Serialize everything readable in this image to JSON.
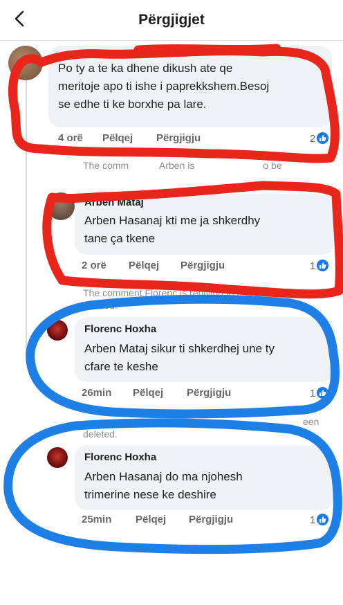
{
  "header": {
    "title": "Përgjigjet",
    "back_icon": "back-arrow-icon"
  },
  "comments": [
    {
      "author": "",
      "text_lines": [
        "Po ty a te ka dhene dikush ate qe",
        "meritoje apo ti ishe i paprekkshem.Besoj",
        "se edhe ti ke borxhe pa lare."
      ],
      "time": "4 orë",
      "like": "Pëlqej",
      "reply": "Përgjigju",
      "likes": "2"
    },
    {
      "author": "Arben Mataj",
      "text_lines": [
        "Arben Hasanaj kti me ja shkerdhy",
        "tane ça tkene"
      ],
      "time": "2 orë",
      "like": "Pëlqej",
      "reply": "Përgjigju",
      "likes": "1"
    },
    {
      "author": "Florenc Hoxha",
      "text_lines": [
        "Arben Mataj sikur ti shkerdhej une ty",
        "cfare te keshe"
      ],
      "time": "26min",
      "like": "Pëlqej",
      "reply": "Përgjigju",
      "likes": "1"
    },
    {
      "author": "Florenc Hoxha",
      "text_lines": [
        "Arben Hasanaj do ma njohesh",
        "trimerine nese ke deshire"
      ],
      "time": "25min",
      "like": "Pëlqej",
      "reply": "Përgjigju",
      "likes": "1"
    }
  ],
  "deleted_notices": [
    "The comment Arben is replying to has been",
    "deleted.",
    "The comment Florenc is replying to has been",
    "deleted.",
    "The comment Florenc is replying to has been",
    "deleted."
  ],
  "deleted_display": [
    "The comm",
    "Arben is",
    "o be",
    "The comment Florenc is replying to has been",
    "deleted.",
    "een",
    "deleted."
  ],
  "colors": {
    "accent": "#1877f2",
    "annotation_red": "#e8261c",
    "annotation_blue": "#1e7fe6"
  }
}
